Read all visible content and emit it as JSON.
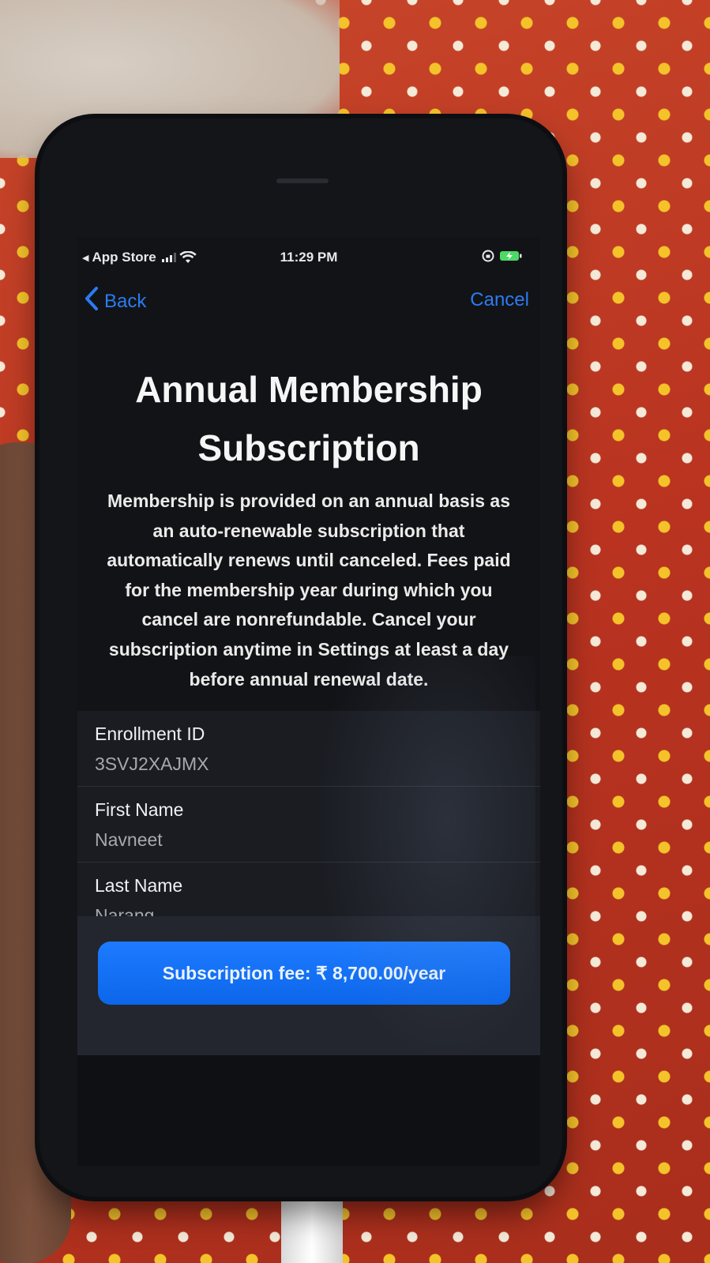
{
  "status_bar": {
    "back_app": "App Store",
    "time": "11:29 PM"
  },
  "nav": {
    "back_label": "Back",
    "cancel_label": "Cancel"
  },
  "page": {
    "title_line1": "Annual Membership",
    "title_line2": "Subscription",
    "description": "Membership is provided on an annual basis as an auto-renewable subscription that automatically renews until canceled. Fees paid for the membership year during which you cancel are nonrefundable. Cancel your subscription anytime in Settings at least a day before annual renewal date."
  },
  "form": {
    "fields": [
      {
        "label": "Enrollment ID",
        "value": "3SVJ2XAJMX"
      },
      {
        "label": "First Name",
        "value": "Navneet"
      },
      {
        "label": "Last Name",
        "value": "Narang"
      }
    ]
  },
  "subscribe": {
    "fee_label": "Subscription fee: ₹ 8,700.00/year"
  },
  "colors": {
    "accent": "#2a7cf2",
    "button": "#0c66ea",
    "screen_bg": "#121317"
  },
  "icons": [
    "back-arrow-icon",
    "signal-icon",
    "wifi-icon",
    "rotation-lock-icon",
    "battery-charging-icon",
    "chevron-left-icon"
  ]
}
